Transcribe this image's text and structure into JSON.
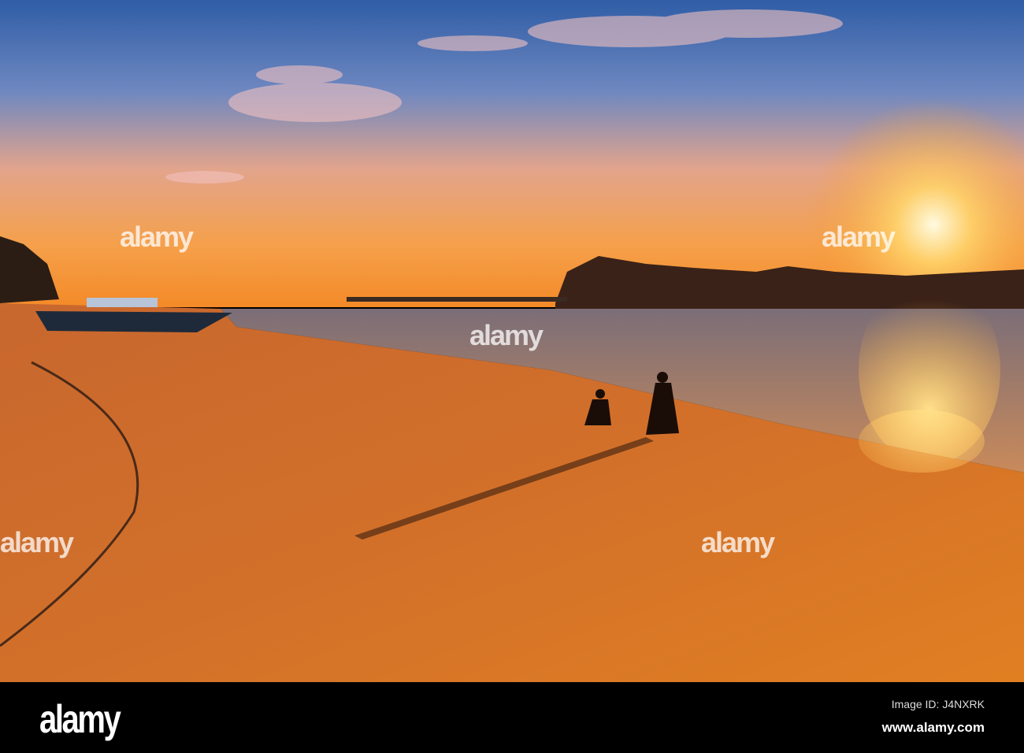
{
  "watermark": {
    "text": "alamy"
  },
  "footer": {
    "logo": "alamy",
    "image_id": "Image ID: J4NXRK",
    "url": "www.alamy.com"
  }
}
